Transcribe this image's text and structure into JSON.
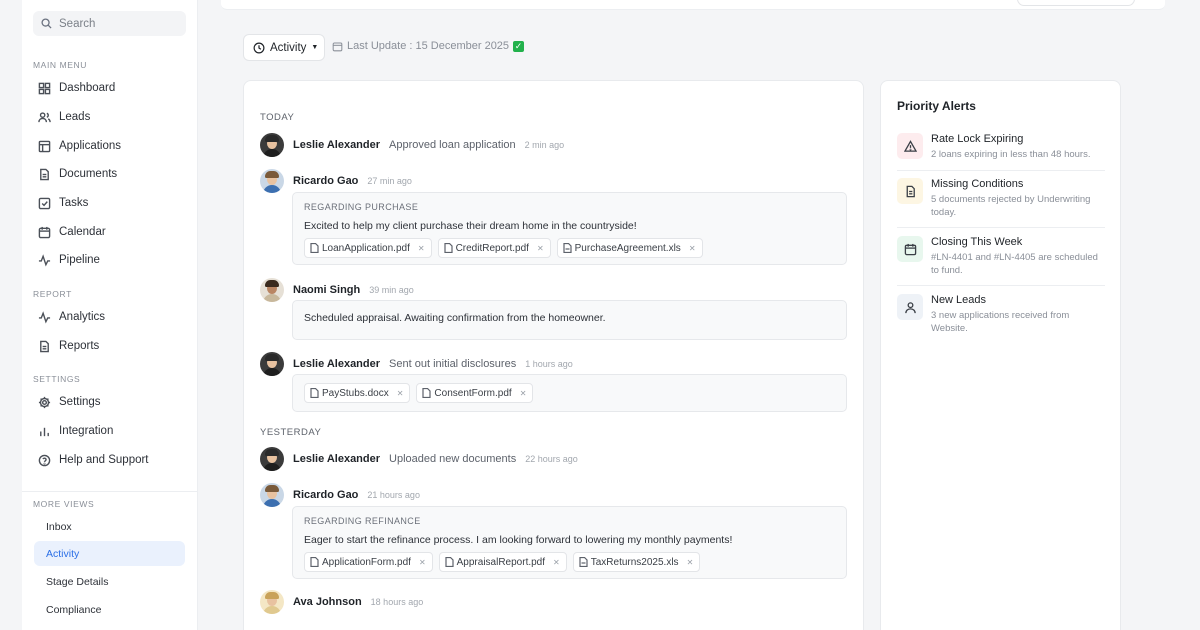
{
  "sidebar": {
    "search_placeholder": "Search",
    "main_menu_label": "MAIN MENU",
    "main_items": [
      "Dashboard",
      "Leads",
      "Applications",
      "Documents",
      "Tasks",
      "Calendar",
      "Pipeline"
    ],
    "report_label": "REPORT",
    "report_items": [
      "Analytics",
      "Reports"
    ],
    "settings_label": "SETTINGS",
    "settings_items": [
      "Settings",
      "Integration",
      "Help and Support"
    ],
    "more_label": "MORE VIEWS",
    "more_items": [
      "Inbox",
      "Activity",
      "Stage Details",
      "Compliance"
    ],
    "active_item": "Activity"
  },
  "filter": {
    "activity_label": "Activity",
    "last_update": "Last Update : 15 December 2025"
  },
  "feed": {
    "today_label": "TODAY",
    "yesterday_label": "YESTERDAY",
    "entries": [
      {
        "name": "Leslie Alexander",
        "action": "Approved loan application",
        "time": "2 min ago"
      },
      {
        "name": "Ricardo Gao",
        "action": "",
        "time": "27 min ago",
        "regarding": "REGARDING PURCHASE",
        "message": "Excited to help my client purchase their dream home in the countryside!",
        "files": [
          "LoanApplication.pdf",
          "CreditReport.pdf",
          "PurchaseAgreement.xls"
        ]
      },
      {
        "name": "Naomi Singh",
        "action": "",
        "time": "39 min ago",
        "message": "Scheduled appraisal. Awaiting confirmation from the homeowner."
      },
      {
        "name": "Leslie Alexander",
        "action": "Sent out initial disclosures",
        "time": "1 hours ago",
        "files": [
          "PayStubs.docx",
          "ConsentForm.pdf"
        ]
      },
      {
        "name": "Leslie Alexander",
        "action": "Uploaded new documents",
        "time": "22 hours ago"
      },
      {
        "name": "Ricardo Gao",
        "action": "",
        "time": "21 hours ago",
        "regarding": "REGARDING REFINANCE",
        "message": "Eager to start the refinance process. I am looking forward to lowering my monthly payments!",
        "files": [
          "ApplicationForm.pdf",
          "AppraisalReport.pdf",
          "TaxReturns2025.xls"
        ]
      },
      {
        "name": "Ava Johnson",
        "action": "",
        "time": "18 hours ago"
      }
    ]
  },
  "alerts": {
    "title": "Priority Alerts",
    "items": [
      {
        "title": "Rate Lock Expiring",
        "desc": "2 loans expiring in less than 48 hours.",
        "icon": "warning-icon",
        "bg": "#fdecee"
      },
      {
        "title": "Missing Conditions",
        "desc": "5 documents rejected by Underwriting today.",
        "icon": "document-icon",
        "bg": "#fdf6e3"
      },
      {
        "title": "Closing This Week",
        "desc": "#LN-4401 and #LN-4405 are scheduled to fund.",
        "icon": "calendar-icon",
        "bg": "#e8f7ee"
      },
      {
        "title": "New Leads",
        "desc": "3 new applications received from Website.",
        "icon": "user-icon",
        "bg": "#eef2f7"
      }
    ]
  },
  "colors": {
    "accent": "#2b6fe6",
    "active_bg": "#eaf1fd"
  }
}
